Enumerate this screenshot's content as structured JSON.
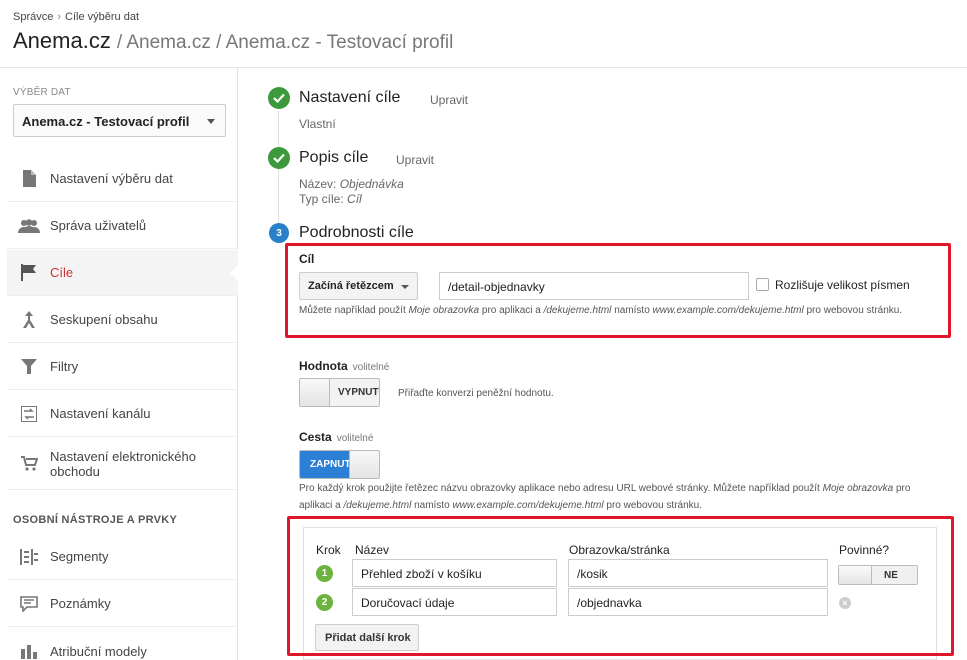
{
  "breadcrumb": [
    "Správce",
    "Cíle výběru dat"
  ],
  "header": {
    "title_main": "Anema.cz",
    "title_rest": "/ Anema.cz / Anema.cz - Testovací profil"
  },
  "sidebar": {
    "section_label": "VÝBĚR DAT",
    "view_select": "Anema.cz - Testovací profil",
    "items": [
      {
        "label": "Nastavení výběru dat",
        "icon": "document-icon"
      },
      {
        "label": "Správa uživatelů",
        "icon": "users-icon"
      },
      {
        "label": "Cíle",
        "icon": "flag-icon",
        "active": true
      },
      {
        "label": "Seskupení obsahu",
        "icon": "grouping-icon"
      },
      {
        "label": "Filtry",
        "icon": "filter-icon"
      },
      {
        "label": "Nastavení kanálu",
        "icon": "channel-icon"
      },
      {
        "label": "Nastavení elektronického obchodu",
        "icon": "cart-icon"
      }
    ],
    "tools_label": "OSOBNÍ NÁSTROJE A PRVKY",
    "tools": [
      {
        "label": "Segmenty",
        "icon": "segments-icon"
      },
      {
        "label": "Poznámky",
        "icon": "comment-icon"
      },
      {
        "label": "Atribuční modely",
        "icon": "attribution-icon"
      }
    ]
  },
  "steps": {
    "step1": {
      "title": "Nastavení cíle",
      "edit": "Upravit",
      "value": "Vlastní"
    },
    "step2": {
      "title": "Popis cíle",
      "edit": "Upravit",
      "name_label": "Název:",
      "name_value": "Objednávka",
      "type_label": "Typ cíle:",
      "type_value": "Cíl"
    },
    "step3": {
      "number": "3",
      "title": "Podrobnosti cíle"
    }
  },
  "goal": {
    "label": "Cíl",
    "match_type": "Začíná řetězcem",
    "value": "/detail-objednavky",
    "case_sensitive_label": "Rozlišuje velikost písmen",
    "help_1": "Můžete například použít",
    "help_em1": "Moje obrazovka",
    "help_2": "pro aplikaci a",
    "help_em2": "/dekujeme.html",
    "help_3": "namísto",
    "help_em3": "www.example.com/dekujeme.html",
    "help_4": "pro webovou stránku."
  },
  "value_field": {
    "label": "Hodnota",
    "optional": "volitelné",
    "toggle": "VYPNUTO",
    "hint": "Přiřaďte konverzi peněžní hodnotu."
  },
  "funnel_field": {
    "label": "Cesta",
    "optional": "volitelné",
    "toggle": "ZAPNUTO",
    "help_1": "Pro každý krok použijte řetězec názvu obrazovky aplikace nebo adresu URL webové stránky. Můžete například použít",
    "help_em1": "Moje obrazovka",
    "help_2": "pro aplikaci a",
    "help_em2": "/dekujeme.html",
    "help_3": "namísto",
    "help_em3": "www.example.com/dekujeme.html",
    "help_4": "pro webovou stránku."
  },
  "funnel": {
    "col_step": "Krok",
    "col_name": "Název",
    "col_page": "Obrazovka/stránka",
    "col_required": "Povinné?",
    "rows": [
      {
        "n": "1",
        "name": "Přehled zboží v košíku",
        "page": "/kosik"
      },
      {
        "n": "2",
        "name": "Doručovací údaje",
        "page": "/objednavka"
      }
    ],
    "required_toggle": "NE",
    "add_step": "Přidat další krok"
  }
}
